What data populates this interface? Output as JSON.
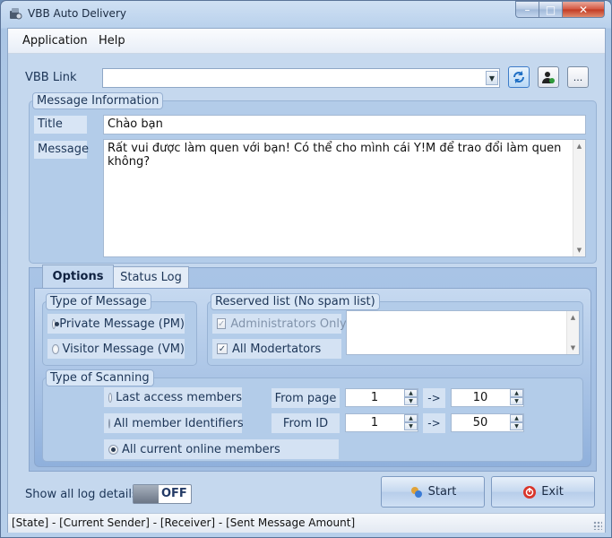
{
  "window": {
    "title": "VBB Auto Delivery",
    "minimize": "–",
    "maximize": "□",
    "close": "✕"
  },
  "menu": {
    "items": [
      "Application",
      "Help"
    ]
  },
  "vbb_link": {
    "label": "VBB Link",
    "value": ""
  },
  "message_info": {
    "group_title": "Message Information",
    "title_label": "Title",
    "title_value": "Chào bạn",
    "message_label": "Message",
    "message_value": "Rất vui được làm quen với bạn! Có thể cho mình cái Y!M để trao đổi làm quen không?"
  },
  "tabs": [
    {
      "label": "Options",
      "active": true
    },
    {
      "label": "Status Log",
      "active": false
    }
  ],
  "type_of_message": {
    "title": "Type of Message",
    "options": [
      {
        "label": "Private Message (PM)",
        "selected": true
      },
      {
        "label": "Visitor Message (VM)",
        "selected": false
      }
    ]
  },
  "reserved_list": {
    "title": "Reserved list (No spam list)",
    "options": [
      {
        "label": "Administrators Only",
        "checked": true,
        "disabled": true
      },
      {
        "label": "All Modertators",
        "checked": true,
        "disabled": false
      }
    ]
  },
  "type_of_scanning": {
    "title": "Type of Scanning",
    "options": [
      {
        "label": "Last access members",
        "selected": false
      },
      {
        "label": "All member Identifiers",
        "selected": false
      },
      {
        "label": "All current online members",
        "selected": true
      }
    ],
    "from_page": {
      "label": "From page",
      "start": "1",
      "arrow": "->",
      "end": "10"
    },
    "from_id": {
      "label": "From ID",
      "start": "1",
      "arrow": "->",
      "end": "50"
    }
  },
  "log_toggle": {
    "label": "Show all log details",
    "state": "OFF"
  },
  "buttons": {
    "start": "Start",
    "exit": "Exit"
  },
  "status_bar": {
    "text": "[State] - [Current Sender] - [Receiver] - [Sent Message Amount]"
  },
  "colors": {
    "accent": "#b3cce9",
    "exit_icon": "#d9352a",
    "start_icon": "#3a7bd5"
  }
}
